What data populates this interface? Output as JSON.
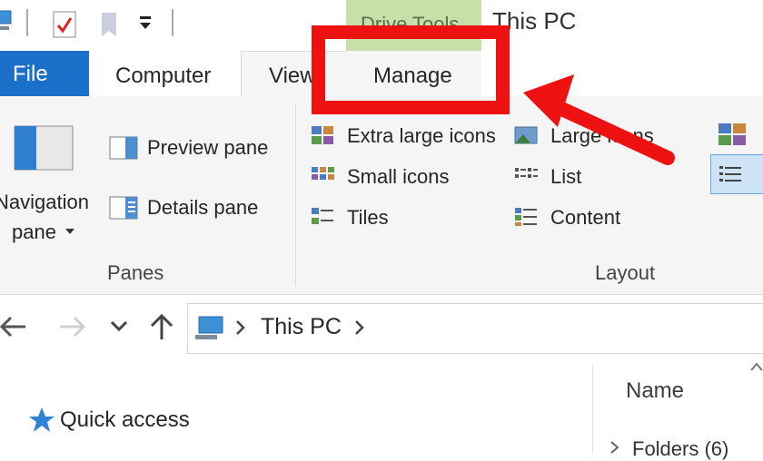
{
  "window": {
    "title": "This PC",
    "context_tab_group": "Drive Tools"
  },
  "tabs": [
    {
      "label": "File"
    },
    {
      "label": "Computer"
    },
    {
      "label": "View"
    },
    {
      "label": "Manage"
    }
  ],
  "ribbon": {
    "panes_group": {
      "navigation_pane_line1": "Navigation",
      "navigation_pane_line2": "pane",
      "preview_pane": "Preview pane",
      "details_pane": "Details pane",
      "label": "Panes"
    },
    "layout_group": {
      "label": "Layout",
      "items": [
        {
          "label": "Extra large icons",
          "icon": "extra-large-icons-icon"
        },
        {
          "label": "Large icons",
          "icon": "large-icons-icon"
        },
        {
          "label": "Small icons",
          "icon": "small-icons-icon"
        },
        {
          "label": "List",
          "icon": "list-icon"
        },
        {
          "label": "Tiles",
          "icon": "tiles-icon"
        },
        {
          "label": "Content",
          "icon": "content-icon"
        }
      ]
    }
  },
  "address_bar": {
    "path": "This PC"
  },
  "navigation_pane": {
    "quick_access": "Quick access"
  },
  "file_list": {
    "name_header": "Name",
    "folders_group": "Folders (6)"
  },
  "colors": {
    "file_tab": "#1a6fc9",
    "drive_tools": "#c7e0a9",
    "annotation": "#ee1111"
  }
}
